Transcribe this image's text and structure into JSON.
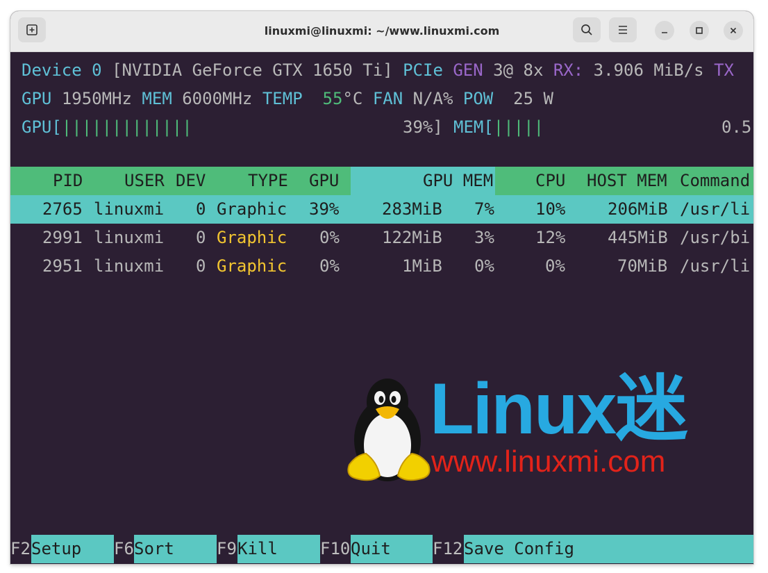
{
  "window": {
    "title": "linuxmi@linuxmi: ~/www.linuxmi.com"
  },
  "status": {
    "device_label": "Device",
    "device_num": "0",
    "device_name": "[NVIDIA GeForce GTX 1650 Ti]",
    "pcie": "PCIe",
    "gen_label": "GEN",
    "gen_value": "3@ 8x",
    "rx_label": "RX:",
    "rx_value": "3.906 MiB/s",
    "tx_label": "TX",
    "gpu_label": "GPU",
    "gpu_clock": "1950MHz",
    "mem_label": "MEM",
    "mem_clock": "6000MHz",
    "temp_label": "TEMP",
    "temp_value": "55",
    "temp_unit": "°C",
    "fan_label": "FAN",
    "fan_value": "N/A%",
    "pow_label": "POW",
    "pow_value": "25 W",
    "gpu_bar_label": "GPU[",
    "gpu_bar_ticks": "|||||||||||||",
    "gpu_bar_value": "39%]",
    "mem_bar_label": "MEM[",
    "mem_bar_ticks": "|||||",
    "mem_bar_value": "0.5"
  },
  "table": {
    "headers": {
      "pid": "PID",
      "user": "USER",
      "dev": "DEV",
      "type": "TYPE",
      "gpu": "GPU",
      "gpu_mem": "GPU MEM",
      "cpu": "CPU",
      "host_mem": "HOST MEM",
      "command": "Command"
    },
    "rows": [
      {
        "pid": "2765",
        "user": "linuxmi",
        "dev": "0",
        "type": "Graphic",
        "gpu": "39%",
        "gpu_mem": "283MiB",
        "gpu_mem_pct": "7%",
        "cpu": "10%",
        "host_mem": "206MiB",
        "command": "/usr/li"
      },
      {
        "pid": "2991",
        "user": "linuxmi",
        "dev": "0",
        "type": "Graphic",
        "gpu": "0%",
        "gpu_mem": "122MiB",
        "gpu_mem_pct": "3%",
        "cpu": "12%",
        "host_mem": "445MiB",
        "command": "/usr/bi"
      },
      {
        "pid": "2951",
        "user": "linuxmi",
        "dev": "0",
        "type": "Graphic",
        "gpu": "0%",
        "gpu_mem": "1MiB",
        "gpu_mem_pct": "0%",
        "cpu": "0%",
        "host_mem": "70MiB",
        "command": "/usr/li"
      }
    ]
  },
  "footer": {
    "f2_key": "F2",
    "f2_label": "Setup",
    "f6_key": "F6",
    "f6_label": "Sort",
    "f9_key": "F9",
    "f9_label": "Kill",
    "f10_key": "F10",
    "f10_label": "Quit",
    "f12_key": "F12",
    "f12_label": "Save Config"
  },
  "watermark": {
    "logo_text": "Linux迷",
    "url": "www.linuxmi.com"
  },
  "colors": {
    "terminal_bg": "#2c1f33",
    "header_green": "#4fbc7a",
    "header_teal": "#5bc8c2",
    "accent_blue": "#5fc0d6",
    "graphic_yellow": "#f2c530"
  },
  "icons": [
    "new-tab-icon",
    "search-icon",
    "hamburger-menu-icon",
    "minimize-icon",
    "maximize-icon",
    "close-icon"
  ]
}
